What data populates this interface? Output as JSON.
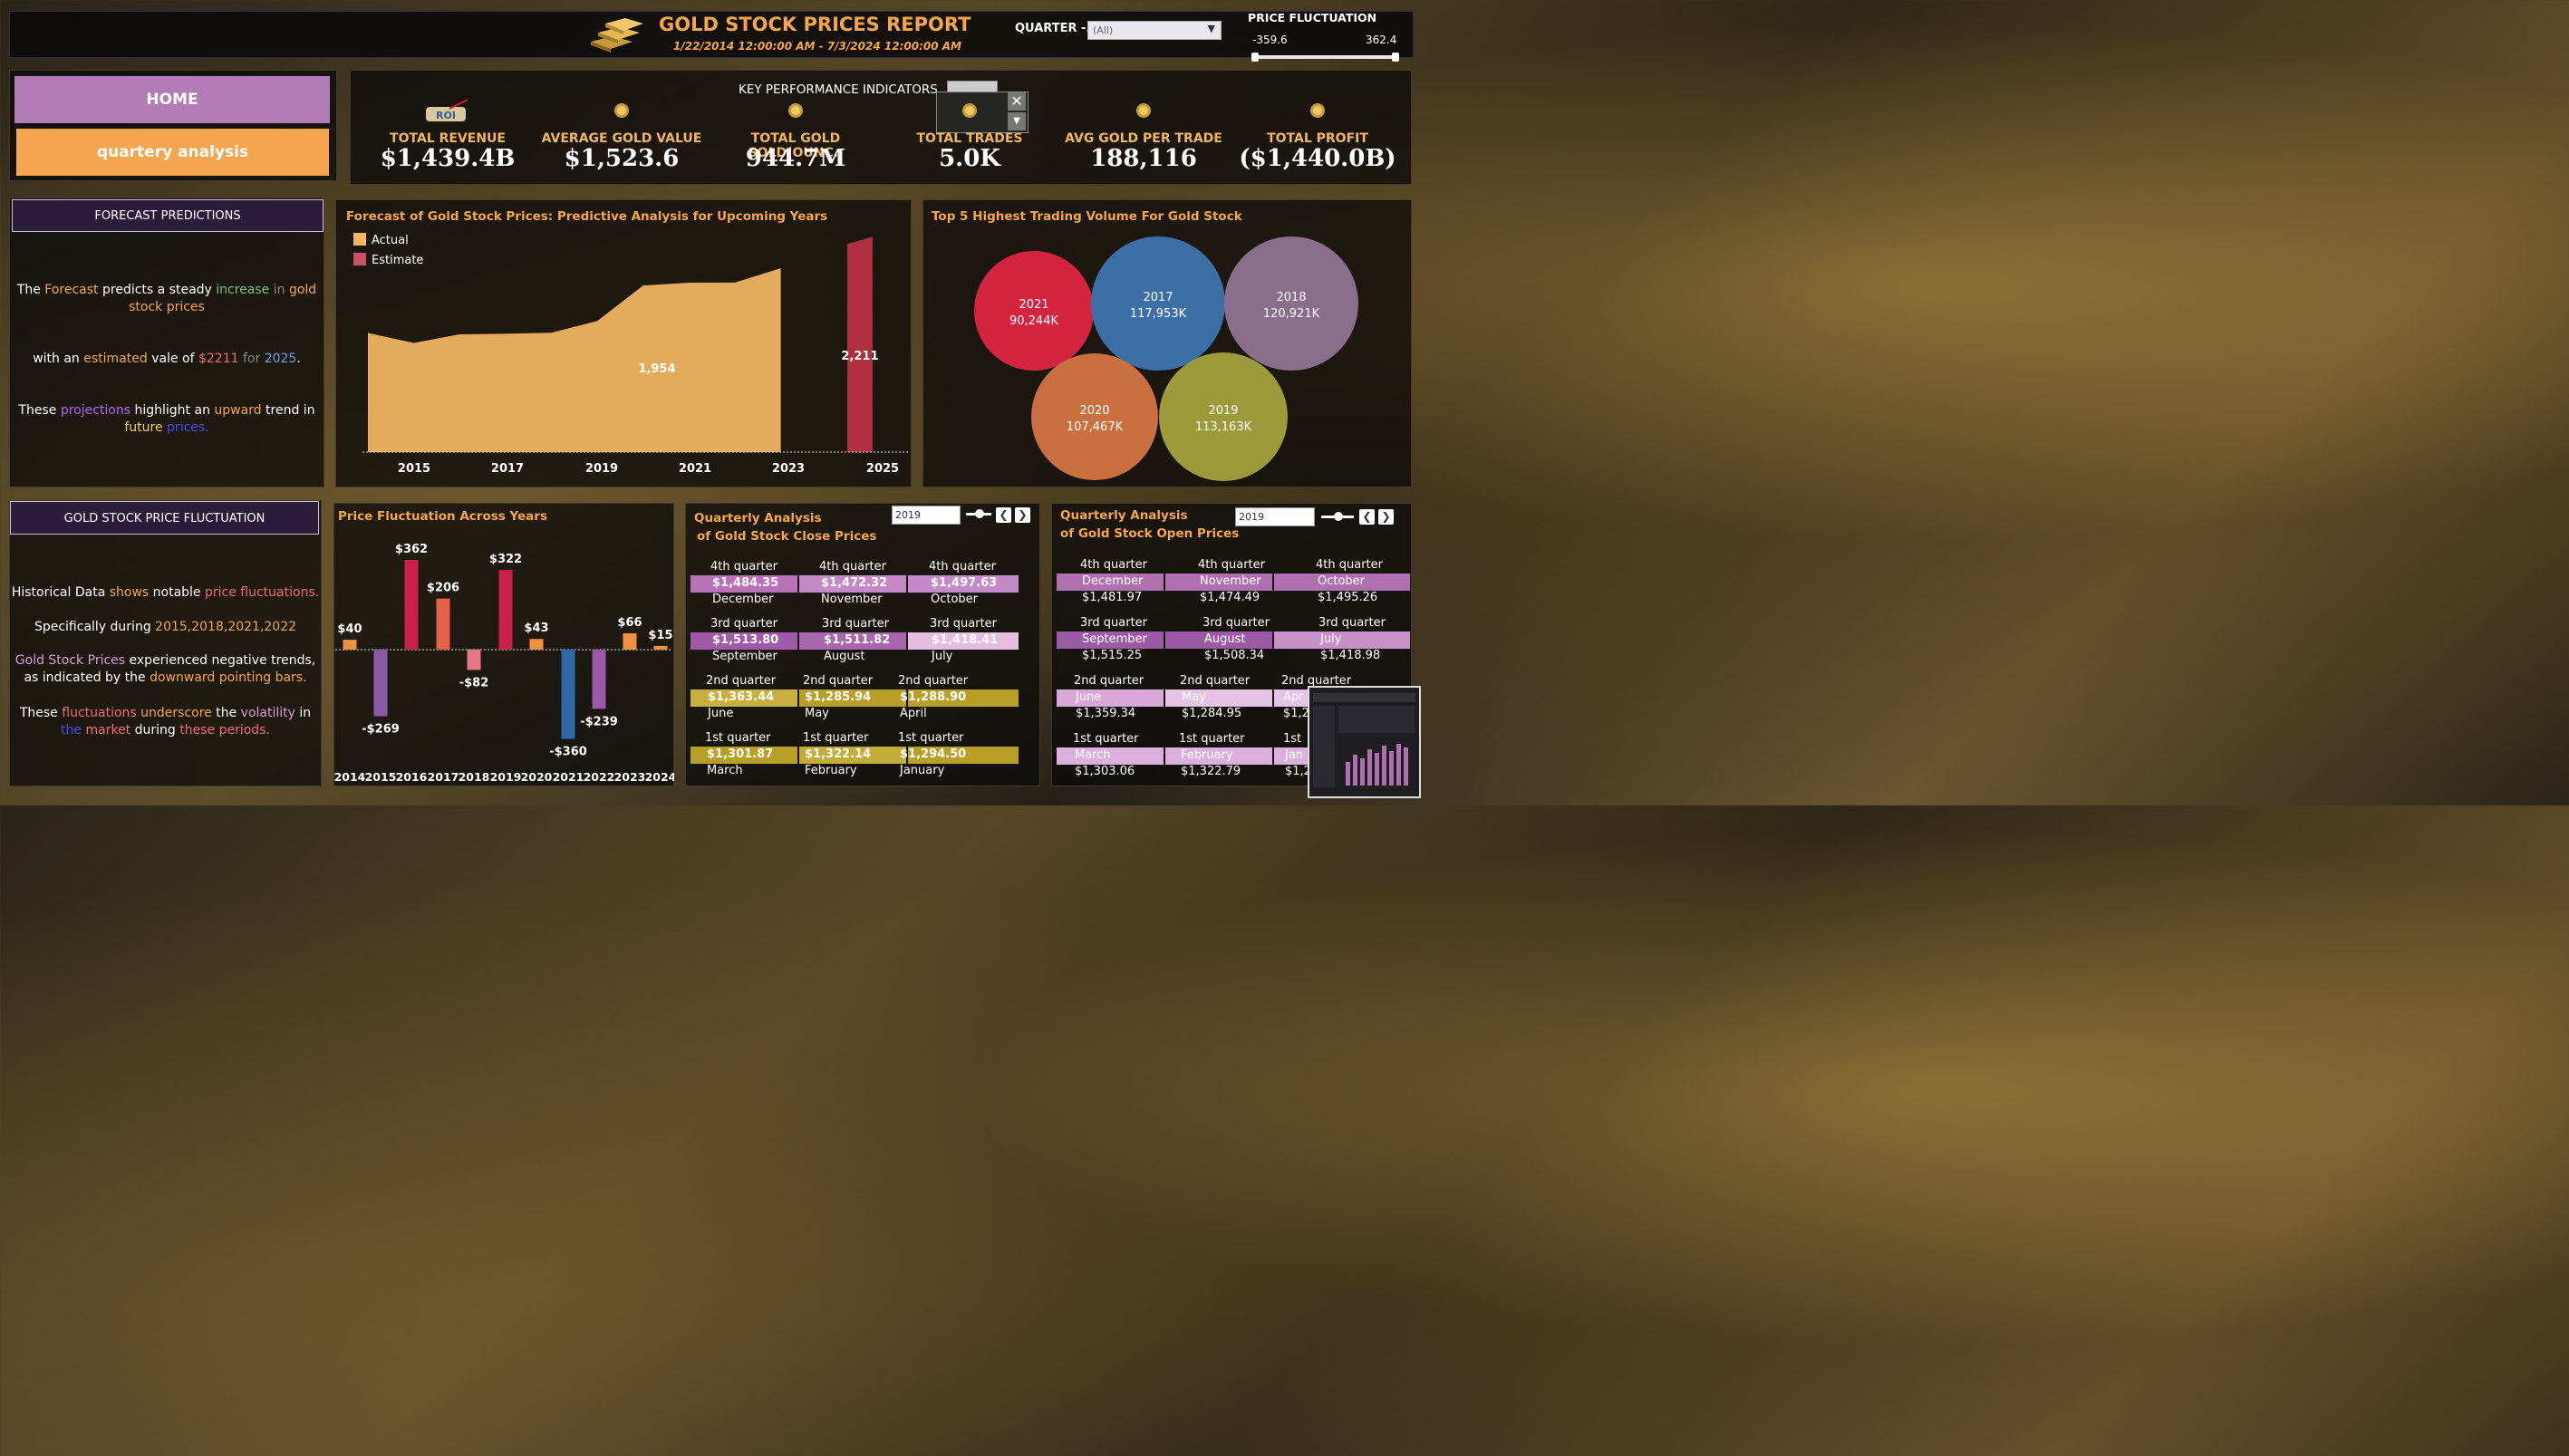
{
  "header": {
    "title": "GOLD STOCK PRICES REPORT",
    "date_range": "1/22/2014 12:00:00 AM - 7/3/2024 12:00:00 AM",
    "quarter_label": "QUARTER -..",
    "quarter_value": "(All)",
    "price_fluct_label": "PRICE FLUCTUATION",
    "price_fluct_min": "-359.6",
    "price_fluct_max": "362.4"
  },
  "nav": {
    "home": "HOME",
    "quarterly": "quartery analysis"
  },
  "kpi": {
    "title": "KEY PERFORMANCE INDICATORS",
    "items": [
      {
        "label": "TOTAL REVENUE",
        "value": "$1,439.4B",
        "icon": "roi-icon"
      },
      {
        "label": "AVERAGE GOLD VALUE",
        "value": "$1,523.6",
        "icon": "gold-bag-icon"
      },
      {
        "label": "TOTAL GOLD SOLD(OUNC..",
        "value": "944.7M",
        "icon": "gold-coin-icon"
      },
      {
        "label": "TOTAL TRADES",
        "value": "5.0K",
        "icon": "gold-coin-icon"
      },
      {
        "label": "AVG GOLD PER TRADE",
        "value": "188,116",
        "icon": "gold-nugget-icon"
      },
      {
        "label": "TOTAL PROFIT",
        "value": "($1,440.0B)",
        "icon": "gold-bar-icon"
      }
    ]
  },
  "forecast_box": {
    "title": "FORECAST PREDICTIONS",
    "p1": {
      "a": "The ",
      "b": "Forecast",
      "c": " predicts a steady ",
      "d": "increase",
      "e": " in ",
      "f": "gold",
      "g": "stock prices"
    },
    "p2": {
      "a": "with an ",
      "b": "estimated",
      "c": " vale of ",
      "d": "$2211",
      "e": " for ",
      "f": "2025",
      "g": "."
    },
    "p3": {
      "a": "These ",
      "b": "projections",
      "c": " highlight an ",
      "d": "upward",
      "e": " trend in",
      "f": "future",
      "g": " ",
      "h": "prices."
    }
  },
  "fluct_box": {
    "title": "GOLD STOCK PRICE FLUCTUATION",
    "p1": {
      "a": "Historical Data ",
      "b": "shows",
      "c": " notable ",
      "d": "price fluctuations."
    },
    "p2": {
      "a": "Specifically  during ",
      "b": "2015,2018,2021,2022"
    },
    "p3": {
      "a": "Gold Stock Prices",
      "b": " experienced negative trends,",
      "c": "as indicated by the ",
      "d": "downward pointing bars."
    },
    "p4": {
      "a": "These ",
      "b": "fluctuations",
      "c": " ",
      "d": "underscore",
      "e": " the ",
      "f": "volatility",
      "g": " in",
      "h": "the ",
      "i": "market",
      "j": " during ",
      "k": "these periods."
    }
  },
  "forecast_chart": {
    "title": "Forecast of Gold Stock Prices: Predictive Analysis for Upcoming Years",
    "legend": [
      {
        "name": "Actual",
        "color": "#f4b864"
      },
      {
        "name": "Estimate",
        "color": "#c9506a"
      }
    ],
    "label_1954": "1,954",
    "label_2211": "2,211",
    "years": [
      "2015",
      "2017",
      "2019",
      "2021",
      "2023",
      "2025"
    ]
  },
  "chart_data": [
    {
      "type": "area",
      "title": "Forecast of Gold Stock Prices: Predictive Analysis for Upcoming Years",
      "series": [
        {
          "name": "Actual",
          "x": [
            2014,
            2015,
            2016,
            2017,
            2018,
            2019,
            2020,
            2021,
            2022,
            2023
          ],
          "values": [
            1266,
            1160,
            1251,
            1257,
            1268,
            1393,
            1769,
            1799,
            1801,
            1954
          ]
        },
        {
          "name": "Estimate",
          "x": [
            2024,
            2025
          ],
          "values": [
            2210,
            2211
          ]
        }
      ],
      "xticks": [
        "2015",
        "2017",
        "2019",
        "2021",
        "2023",
        "2025"
      ],
      "ylim": [
        0,
        2300
      ]
    },
    {
      "type": "scatter",
      "title": "Top 5 Highest Trading Volume For Gold Stock",
      "categories": [
        "2021",
        "2017",
        "2018",
        "2020",
        "2019"
      ],
      "values": [
        90244,
        117953,
        120921,
        107467,
        113163
      ],
      "labels": [
        "90,244K",
        "117,953K",
        "120,921K",
        "107,467K",
        "113,163K"
      ],
      "colors": [
        "#d4243f",
        "#3c6fa6",
        "#8a6e8c",
        "#c87040",
        "#9c9a3a"
      ]
    },
    {
      "type": "bar",
      "title": "Price Fluctuation Across Years",
      "categories": [
        "2014",
        "2015",
        "2016",
        "2017",
        "2018",
        "2019",
        "2020",
        "2021",
        "2022",
        "2023",
        "2024"
      ],
      "values": [
        40,
        -269,
        362,
        206,
        -82,
        322,
        43,
        -360,
        -239,
        66,
        15
      ],
      "labels": [
        "$40",
        "-$269",
        "$362",
        "$206",
        "-$82",
        "$322",
        "$43",
        "-$360",
        "-$239",
        "$66",
        "$15"
      ],
      "colors": [
        "#f09040",
        "#8a5aa8",
        "#c8204a",
        "#e8604a",
        "#e87888",
        "#c8204a",
        "#f09040",
        "#2f6aa8",
        "#9a5aa8",
        "#f09040",
        "#f09040"
      ]
    }
  ],
  "bubble_title": "Top 5 Highest Trading Volume For Gold Stock",
  "bar_title": "Price Fluctuation Across Years",
  "q_close": {
    "title1": "Quarterly Analysis",
    "title2": "of Gold Stock Close Prices",
    "year": "2019",
    "rows": [
      {
        "q": [
          "4th quarter",
          "4th quarter",
          "4th quarter"
        ],
        "v": [
          "$1,484.35",
          "$1,472.32",
          "$1,497.63"
        ],
        "m": [
          "December",
          "November",
          "October"
        ],
        "colors": [
          "#b772b8",
          "#c48ac8",
          "#c48ac8"
        ]
      },
      {
        "q": [
          "3rd quarter",
          "3rd quarter",
          "3rd quarter"
        ],
        "v": [
          "$1,513.80",
          "$1,511.82",
          "$1,418.41"
        ],
        "m": [
          "September",
          "August",
          "July"
        ],
        "colors": [
          "#a05aa8",
          "#a866ac",
          "#e4bde0"
        ]
      },
      {
        "q": [
          "2nd quarter",
          "2nd quarter",
          "2nd quarter"
        ],
        "v": [
          "$1,363.44",
          "$1,285.94",
          "$1,288.90"
        ],
        "m": [
          "June",
          "May",
          "April"
        ],
        "colors": [
          "#c8b040",
          "#b8a028",
          "#b8a028"
        ]
      },
      {
        "q": [
          "1st quarter",
          "1st quarter",
          "1st quarter"
        ],
        "v": [
          "$1,301.87",
          "$1,322.14",
          "$1,294.50"
        ],
        "m": [
          "March",
          "February",
          "January"
        ],
        "colors": [
          "#b8a028",
          "#c4ac38",
          "#b8a028"
        ]
      }
    ]
  },
  "q_open": {
    "title1": "Quarterly Analysis",
    "title2": "of Gold Stock Open Prices",
    "year": "2019",
    "rows": [
      {
        "q": [
          "4th quarter",
          "4th quarter",
          "4th quarter"
        ],
        "m": [
          "December",
          "November",
          "October"
        ],
        "v": [
          "$1,481.97",
          "$1,474.49",
          "$1,495.26"
        ],
        "colors": [
          "#b070b0",
          "#b070b0",
          "#b070b0"
        ]
      },
      {
        "q": [
          "3rd quarter",
          "3rd quarter",
          "3rd quarter"
        ],
        "m": [
          "September",
          "August",
          "July"
        ],
        "v": [
          "$1,515.25",
          "$1,508.34",
          "$1,418.98"
        ],
        "colors": [
          "#9c5aa4",
          "#9c5aa4",
          "#c890c8"
        ]
      },
      {
        "q": [
          "2nd quarter",
          "2nd quarter",
          "2nd quarter"
        ],
        "m": [
          "June",
          "May",
          "Apr"
        ],
        "v": [
          "$1,359.34",
          "$1,284.95",
          "$1,2"
        ],
        "colors": [
          "#d8a8d8",
          "#e6c2e6",
          "#e6c2e6"
        ]
      },
      {
        "q": [
          "1st quarter",
          "1st quarter",
          "1st"
        ],
        "m": [
          "March",
          "February",
          "Jan"
        ],
        "v": [
          "$1,303.06",
          "$1,322.79",
          "$1,2"
        ],
        "colors": [
          "#dcb0dc",
          "#dcb0dc",
          "#dcb0dc"
        ]
      }
    ]
  }
}
